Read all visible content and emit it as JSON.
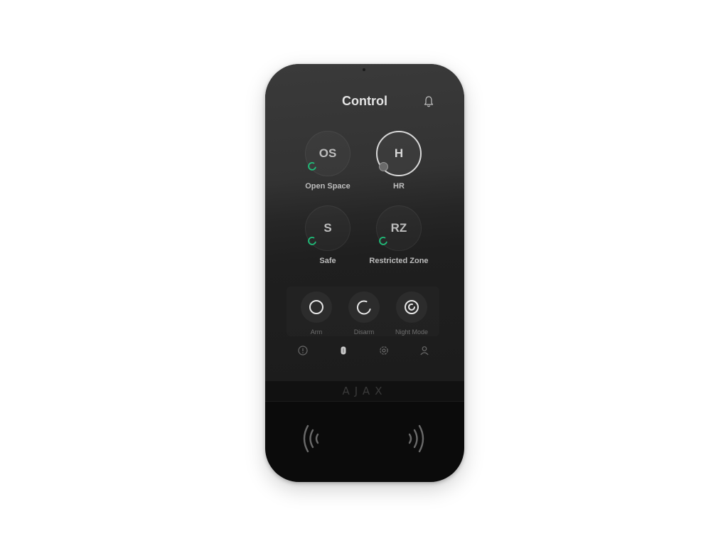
{
  "screen": {
    "title": "Control"
  },
  "groups": [
    {
      "abbr": "OS",
      "label": "Open Space",
      "selected": false,
      "status": "disarmed"
    },
    {
      "abbr": "H",
      "label": "HR",
      "selected": true,
      "status": "selected"
    },
    {
      "abbr": "S",
      "label": "Safe",
      "selected": false,
      "status": "disarmed"
    },
    {
      "abbr": "RZ",
      "label": "Restricted Zone",
      "selected": false,
      "status": "disarmed"
    }
  ],
  "modes": [
    {
      "label": "Arm",
      "icon": "arm-icon"
    },
    {
      "label": "Disarm",
      "icon": "disarm-icon"
    },
    {
      "label": "Night Mode",
      "icon": "night-mode-icon"
    }
  ],
  "nav": [
    "alarm-icon",
    "tag-icon",
    "settings-icon",
    "user-icon"
  ],
  "brand": {
    "logo": "AJAX"
  },
  "colors": {
    "status_green": "#1fbf7a",
    "screen_bg": "#2a2a2a",
    "device_body": "#0b0b0b"
  }
}
